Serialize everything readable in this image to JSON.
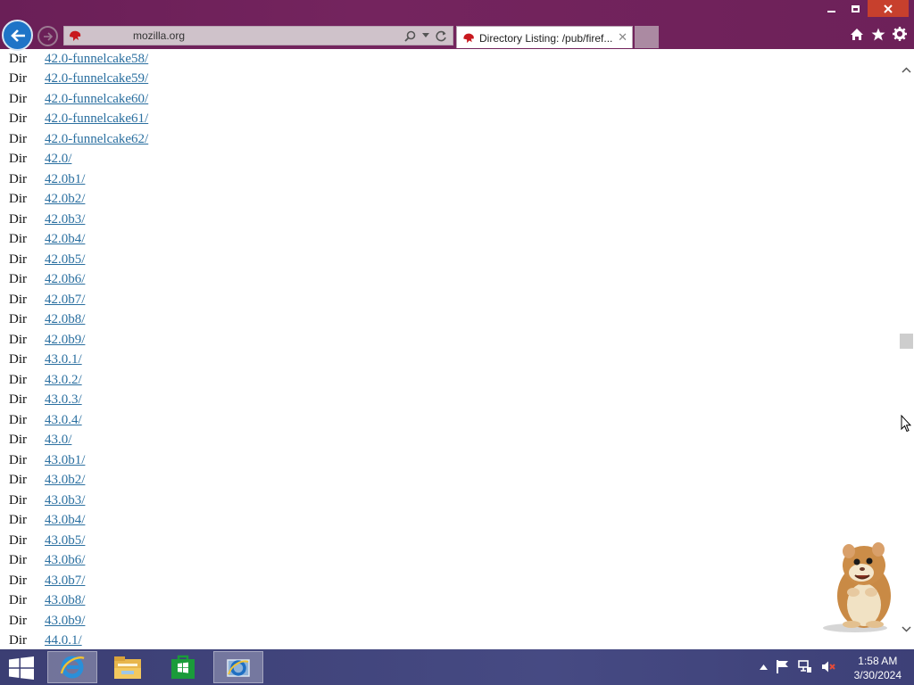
{
  "window": {
    "minimize_icon": "minimize-icon",
    "restore_icon": "restore-icon",
    "close_icon": "close-icon"
  },
  "browser": {
    "address": "mozilla.org",
    "tab_title": "Directory Listing: /pub/firef...",
    "accent_color": "#6d2159"
  },
  "listing": [
    {
      "type": "Dir",
      "name": "42.0-funnelcake58/"
    },
    {
      "type": "Dir",
      "name": "42.0-funnelcake59/"
    },
    {
      "type": "Dir",
      "name": "42.0-funnelcake60/"
    },
    {
      "type": "Dir",
      "name": "42.0-funnelcake61/"
    },
    {
      "type": "Dir",
      "name": "42.0-funnelcake62/"
    },
    {
      "type": "Dir",
      "name": "42.0/"
    },
    {
      "type": "Dir",
      "name": "42.0b1/"
    },
    {
      "type": "Dir",
      "name": "42.0b2/"
    },
    {
      "type": "Dir",
      "name": "42.0b3/"
    },
    {
      "type": "Dir",
      "name": "42.0b4/"
    },
    {
      "type": "Dir",
      "name": "42.0b5/"
    },
    {
      "type": "Dir",
      "name": "42.0b6/"
    },
    {
      "type": "Dir",
      "name": "42.0b7/"
    },
    {
      "type": "Dir",
      "name": "42.0b8/"
    },
    {
      "type": "Dir",
      "name": "42.0b9/"
    },
    {
      "type": "Dir",
      "name": "43.0.1/"
    },
    {
      "type": "Dir",
      "name": "43.0.2/"
    },
    {
      "type": "Dir",
      "name": "43.0.3/"
    },
    {
      "type": "Dir",
      "name": "43.0.4/"
    },
    {
      "type": "Dir",
      "name": "43.0/"
    },
    {
      "type": "Dir",
      "name": "43.0b1/"
    },
    {
      "type": "Dir",
      "name": "43.0b2/"
    },
    {
      "type": "Dir",
      "name": "43.0b3/"
    },
    {
      "type": "Dir",
      "name": "43.0b4/"
    },
    {
      "type": "Dir",
      "name": "43.0b5/"
    },
    {
      "type": "Dir",
      "name": "43.0b6/"
    },
    {
      "type": "Dir",
      "name": "43.0b7/"
    },
    {
      "type": "Dir",
      "name": "43.0b8/"
    },
    {
      "type": "Dir",
      "name": "43.0b9/"
    },
    {
      "type": "Dir",
      "name": "44.0.1/"
    }
  ],
  "taskbar": {
    "items": [
      "internet-explorer-icon",
      "file-explorer-icon",
      "store-icon",
      "ie-window-icon"
    ],
    "time": "1:58 AM",
    "date": "3/30/2024"
  }
}
